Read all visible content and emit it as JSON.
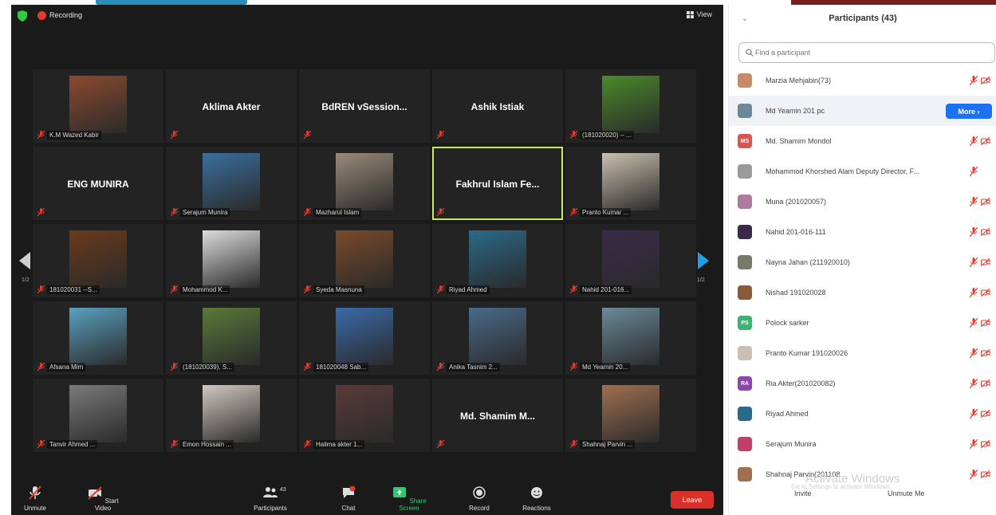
{
  "meeting": {
    "recording_label": "Recording",
    "view_label": "View",
    "page_left": "1/2",
    "page_right": "1/2",
    "tiles": [
      {
        "type": "photo",
        "name": "K.M Wazed Kabir",
        "color": "#8b4a2f"
      },
      {
        "type": "text",
        "name": "Aklima Akter",
        "small": ""
      },
      {
        "type": "text",
        "name": "BdREN vSession...",
        "small": ""
      },
      {
        "type": "text",
        "name": "Ashik Istiak",
        "small": ""
      },
      {
        "type": "photo",
        "name": "(181020020) -- ...",
        "color": "#4a8a2a"
      },
      {
        "type": "text",
        "name": "ENG MUNIRA",
        "small": ""
      },
      {
        "type": "photo",
        "name": "Serajum Munira",
        "color": "#3a6f9e"
      },
      {
        "type": "photo",
        "name": "Mazharul Islam",
        "color": "#9a8a7a"
      },
      {
        "type": "text-active",
        "name": "Fakhrul Islam Fe...",
        "small": ""
      },
      {
        "type": "photo",
        "name": "Pranto Kumar ...",
        "color": "#c9c0b0"
      },
      {
        "type": "photo",
        "name": "181020031 --S...",
        "color": "#6a3a1a"
      },
      {
        "type": "photo",
        "name": "Mohammod K...",
        "color": "#dcdcdc"
      },
      {
        "type": "photo",
        "name": "Syeda Masnuna",
        "color": "#7a4a2a"
      },
      {
        "type": "photo",
        "name": "Riyad Ahmed",
        "color": "#2a6a8a"
      },
      {
        "type": "photo",
        "name": "Nahid 201-016...",
        "color": "#3a2a4a"
      },
      {
        "type": "photo",
        "name": "Afsana Mim",
        "color": "#5aa0c0"
      },
      {
        "type": "photo",
        "name": "(181020039), S...",
        "color": "#5a7a3a"
      },
      {
        "type": "photo",
        "name": "181020048 Sab...",
        "color": "#3a6aaa"
      },
      {
        "type": "photo",
        "name": "Anika Tasnim 2...",
        "color": "#4a6a8a"
      },
      {
        "type": "photo",
        "name": "Md Yeamin 20...",
        "color": "#6a8a9a"
      },
      {
        "type": "photo",
        "name": "Tanvir Ahmed ...",
        "color": "#7a7a7a"
      },
      {
        "type": "photo",
        "name": "Emon Hossain ...",
        "color": "#d0c8c0"
      },
      {
        "type": "photo",
        "name": "Halima akter 1...",
        "color": "#5a3a3a"
      },
      {
        "type": "text",
        "name": "Md. Shamim M...",
        "small": ""
      },
      {
        "type": "photo",
        "name": "Shahnaj Parvin ...",
        "color": "#a07050"
      }
    ]
  },
  "toolbar": {
    "unmute": "Unmute",
    "start_video": "Start Video",
    "participants": "Participants",
    "participants_count": "43",
    "chat": "Chat",
    "share_screen": "Share Screen",
    "record": "Record",
    "reactions": "Reactions",
    "leave": "Leave"
  },
  "panel": {
    "title": "Participants (43)",
    "search_placeholder": "Find a participant",
    "more_label": "More ›",
    "participants": [
      {
        "name": "Marzia Mehjabin(73)",
        "initials": "",
        "color": "#c98a6a"
      },
      {
        "name": "Md Yeamin 201 pc",
        "initials": "",
        "color": "#6a8a9a"
      },
      {
        "name": "Md. Shamim Mondol",
        "initials": "MS",
        "color": "#d9534f"
      },
      {
        "name": "Mohammod Khorshed Alam Deputy Director, F...",
        "initials": "",
        "color": "#9a9a9a"
      },
      {
        "name": "Muna (201020057)",
        "initials": "",
        "color": "#b07aa0"
      },
      {
        "name": "Nahid 201-016-111",
        "initials": "",
        "color": "#3a2a4a"
      },
      {
        "name": "Nayna Jahan (211920010)",
        "initials": "",
        "color": "#7a7a6a"
      },
      {
        "name": "Nishad 191020028",
        "initials": "",
        "color": "#8a5a3a"
      },
      {
        "name": "Polock sarker",
        "initials": "PS",
        "color": "#3cb371"
      },
      {
        "name": "Pranto Kumar 191020026",
        "initials": "",
        "color": "#c9c0b0"
      },
      {
        "name": "Ria Akter(201020082)",
        "initials": "RA",
        "color": "#8e44ad"
      },
      {
        "name": "Riyad Ahmed",
        "initials": "",
        "color": "#2a6a8a"
      },
      {
        "name": "Serajum Munira",
        "initials": "",
        "color": "#c0406a"
      },
      {
        "name": "Shahnaj Parvin(201108",
        "initials": "",
        "color": "#a07050"
      }
    ],
    "watermark_title": "Activate Windows",
    "watermark_sub": "Go to Settings to activate Windows.",
    "invite": "Invite",
    "unmute_me": "Unmute Me"
  }
}
